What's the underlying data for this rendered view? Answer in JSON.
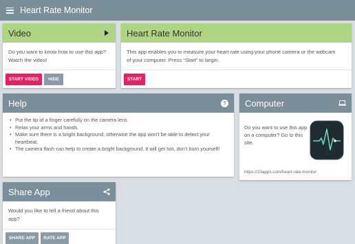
{
  "topbar": {
    "title": "Heart Rate Monitor"
  },
  "video_card": {
    "title": "Video",
    "text": "Do you want to know how to use this app? Watch the video!",
    "start_button": "START VIDEO",
    "hide_button": "HIDE"
  },
  "hrm_card": {
    "title": "Heart Rate Monitor",
    "text": "This app enables you to measure your heart rate using your phone camera or the webcam of your computer. Press “Start” to begin.",
    "start_button": "START"
  },
  "help_card": {
    "title": "Help",
    "icon_glyph": "?",
    "items": [
      "Put the tip of a finger carefully on the camera lens.",
      "Relax your arms and hands.",
      "Make sure there is a bright background, otherwise the app won't be able to detect your heartbeat.",
      "The camera flash can help to create a bright background. It will get hot, don't burn yourself!"
    ]
  },
  "computer_card": {
    "title": "Computer",
    "text": "Do you want to use this app on a computer? Go to this site.",
    "url": "https://23apps.com/heart-rate-monitor"
  },
  "share_card": {
    "title": "Share App",
    "text": "Would you like to tell a friend about this app?",
    "share_button": "SHARE APP",
    "rate_button": "RATE APP"
  },
  "colors": {
    "header_slate": "#7b8f9a",
    "header_green": "#aed582",
    "accent_pink": "#e91e63",
    "button_gray": "#8a9ba5",
    "background": "#d9dee2"
  }
}
